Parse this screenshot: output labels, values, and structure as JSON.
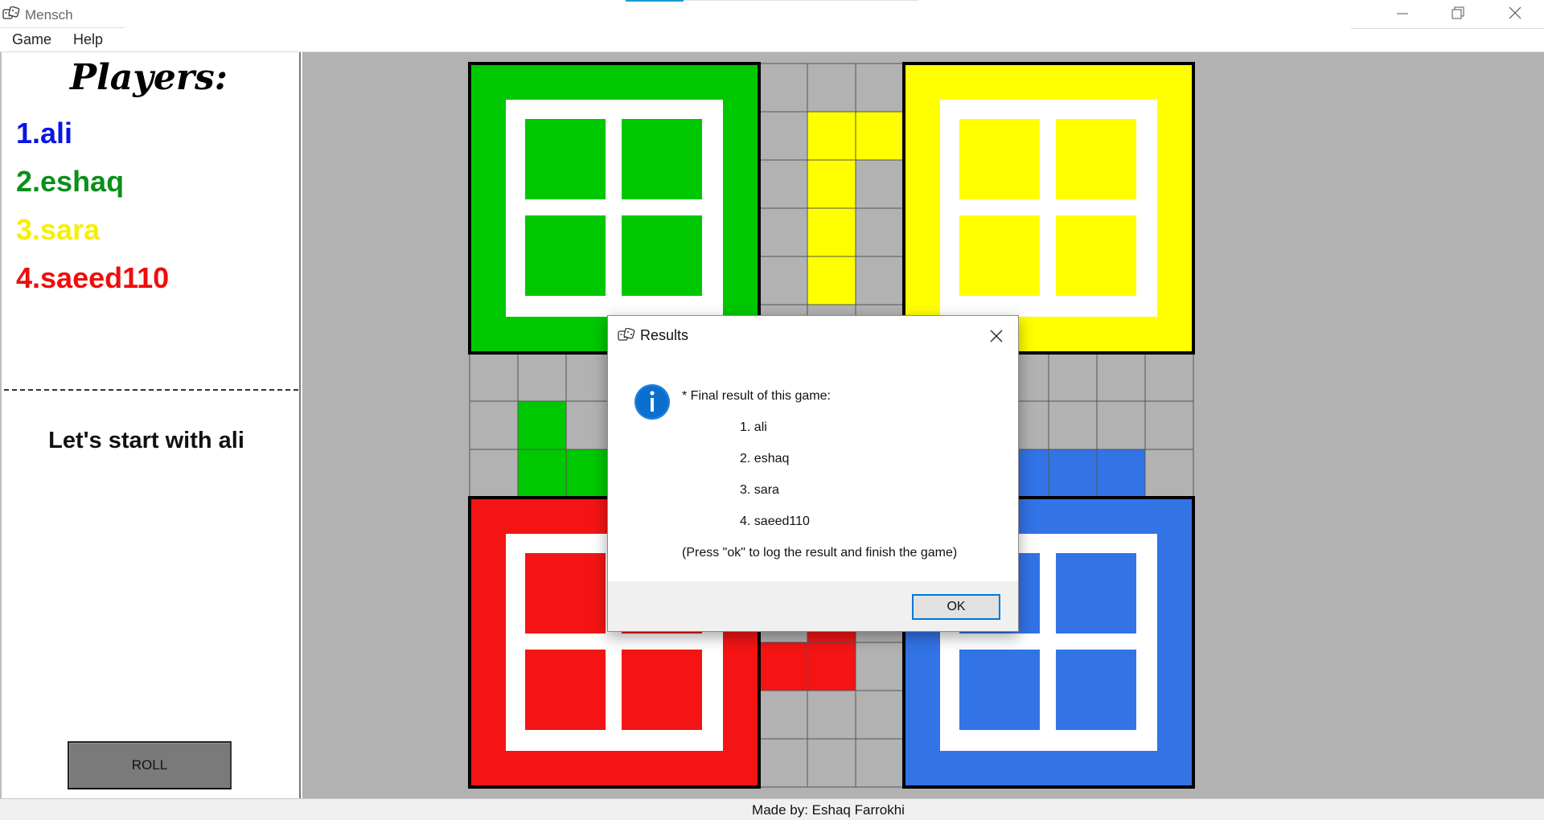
{
  "window": {
    "title": "Mensch",
    "app_icon": "dice-icon",
    "controls": [
      "minimize-icon",
      "restore-icon",
      "close-icon"
    ]
  },
  "menu": {
    "items": [
      {
        "label": "Game"
      },
      {
        "label": "Help"
      }
    ]
  },
  "sidebar": {
    "heading": "Players:",
    "players": [
      {
        "label": "1.ali",
        "color": "#0a14e6"
      },
      {
        "label": "2.eshaq",
        "color": "#0a8f1a"
      },
      {
        "label": "3.sara",
        "color": "#f7ef00"
      },
      {
        "label": "4.saeed110",
        "color": "#f00d0d"
      }
    ],
    "status": "Let's start with ali",
    "roll_label": "ROLL"
  },
  "board": {
    "colors": {
      "green": "#00c800",
      "yellow": "#ffff00",
      "red": "#f41414",
      "blue": "#3273e6",
      "cell": "#b2b2b2"
    }
  },
  "dialog": {
    "title": "Results",
    "icon": "info-icon",
    "lines": [
      "* Final result of this game:",
      "1. ali",
      "2. eshaq",
      "3. sara",
      "4. saeed110",
      "(Press \"ok\" to log the result and finish the game)"
    ],
    "ok_label": "OK"
  },
  "footer": {
    "credit": "Made by: Eshaq Farrokhi"
  }
}
